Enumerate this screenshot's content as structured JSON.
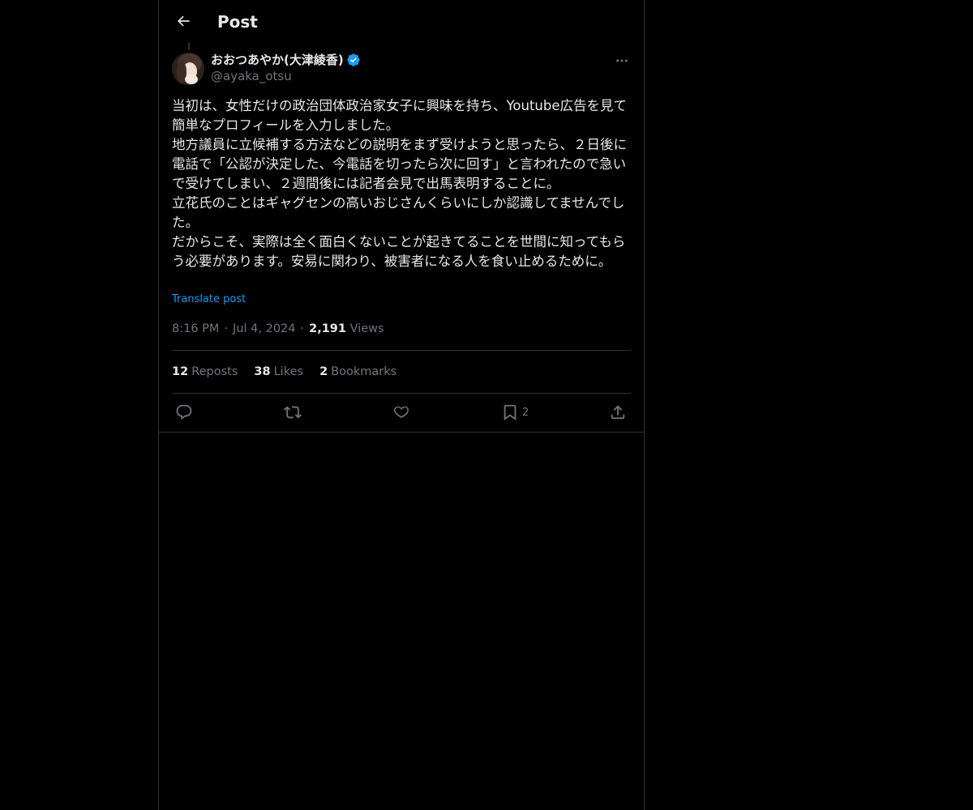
{
  "header": {
    "title": "Post"
  },
  "author": {
    "display_name": "おおつあやか(大津綾香)",
    "handle": "@ayaka_otsu",
    "verified": true
  },
  "post": {
    "text": "当初は、女性だけの政治団体政治家女子に興味を持ち、Youtube広告を見て簡単なプロフィールを入力しました。\n地方議員に立候補する方法などの説明をまず受けようと思ったら、２日後に電話で「公認が決定した、今電話を切ったら次に回す」と言われたので急いで受けてしまい、２週間後には記者会見で出馬表明することに。\n立花氏のことはギャグセンの高いおじさんくらいにしか認識してませんでした。\nだからこそ、実際は全く面白くないことが起きてることを世間に知ってもらう必要があります。安易に関わり、被害者になる人を食い止めるために。",
    "translate_label": "Translate post",
    "time": "8:16 PM",
    "date": "Jul 4, 2024",
    "views_count": "2,191",
    "views_label": "Views"
  },
  "stats": {
    "reposts_count": "12",
    "reposts_label": "Reposts",
    "likes_count": "38",
    "likes_label": "Likes",
    "bookmarks_count": "2",
    "bookmarks_label": "Bookmarks"
  },
  "actions": {
    "bookmark_count": "2",
    "icons": [
      "reply-icon",
      "repost-icon",
      "like-icon",
      "bookmark-icon",
      "share-icon"
    ]
  },
  "colors": {
    "background": "#000000",
    "text": "#e7e9ea",
    "muted": "#71767b",
    "accent": "#1d9bf0",
    "border": "#2f3336"
  }
}
